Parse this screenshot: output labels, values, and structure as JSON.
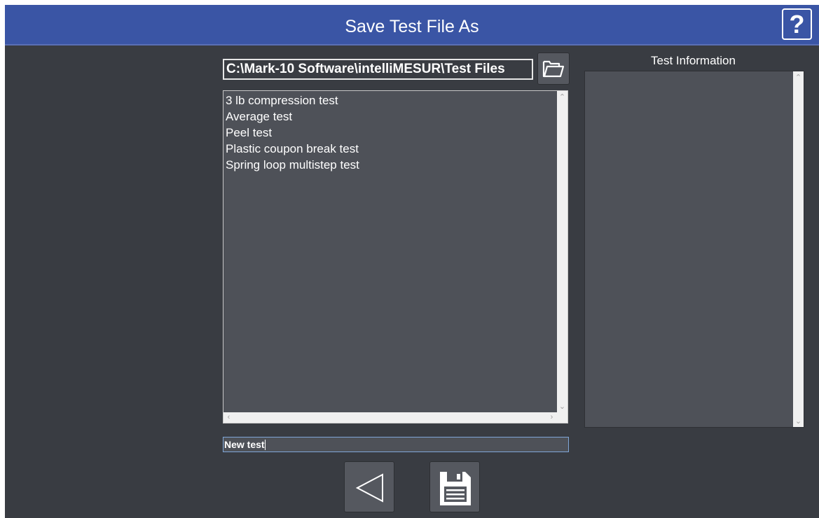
{
  "window": {
    "title": "Save Test File As",
    "help_label": "?"
  },
  "path": {
    "value": "C:\\Mark-10 Software\\intelliMESUR\\Test Files"
  },
  "file_list": {
    "items": [
      "3 lb compression test",
      "Average test",
      "Peel test",
      "Plastic coupon break test",
      "Spring loop multistep test"
    ]
  },
  "info_panel": {
    "label": "Test Information",
    "content": ""
  },
  "filename": {
    "value": "New test"
  },
  "icons": {
    "folder": "folder-open-icon",
    "back": "back-triangle-icon",
    "save": "floppy-disk-icon",
    "help": "question-icon"
  },
  "colors": {
    "title_bar": "#3a55a5",
    "background": "#393c42",
    "panel": "#4e5158",
    "button": "#55585f"
  }
}
